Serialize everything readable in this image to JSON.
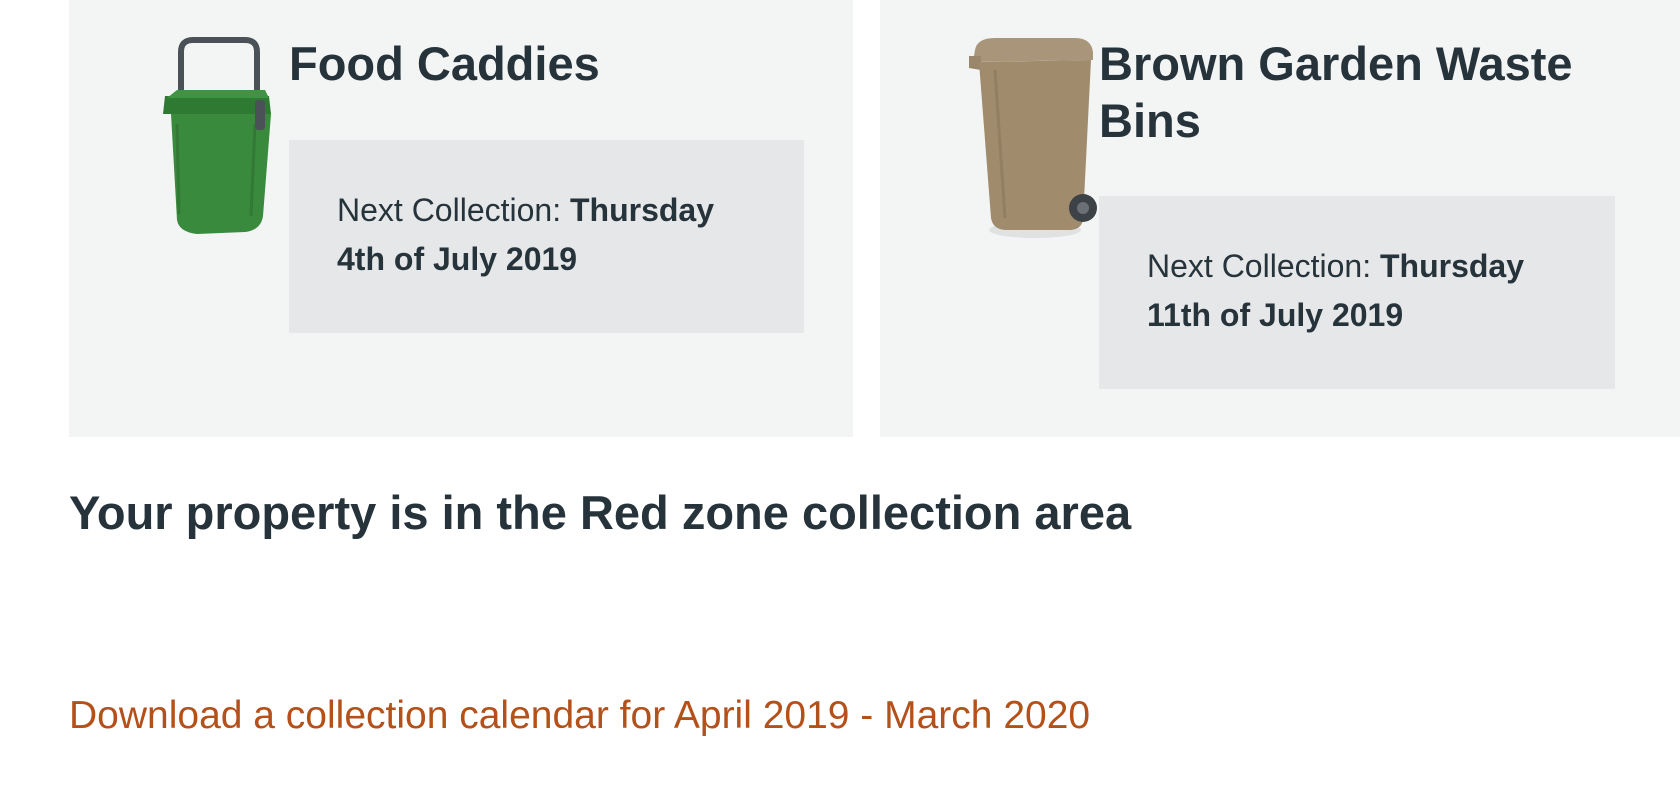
{
  "cards": [
    {
      "title": "Food Caddies",
      "icon": "green-food-caddy-icon",
      "next_label": "Next Collection:",
      "next_date": "Thursday 4th of July 2019"
    },
    {
      "title": "Brown Garden Waste Bins",
      "icon": "brown-wheelie-bin-icon",
      "next_label": "Next Collection:",
      "next_date": "Thursday 11th of July 2019"
    }
  ],
  "zone": {
    "prefix": "Your property is in the",
    "zone_name": "Red zone",
    "suffix": "collection area"
  },
  "calendar_link": {
    "text": "Download a collection calendar for April 2019 - March 2020"
  },
  "colors": {
    "link": "#b4501a",
    "text": "#26333b",
    "card_bg": "#f3f4f4",
    "box_bg": "#e5e7e8",
    "caddy_green": "#3a8a3e",
    "bin_brown": "#a08b6c"
  }
}
